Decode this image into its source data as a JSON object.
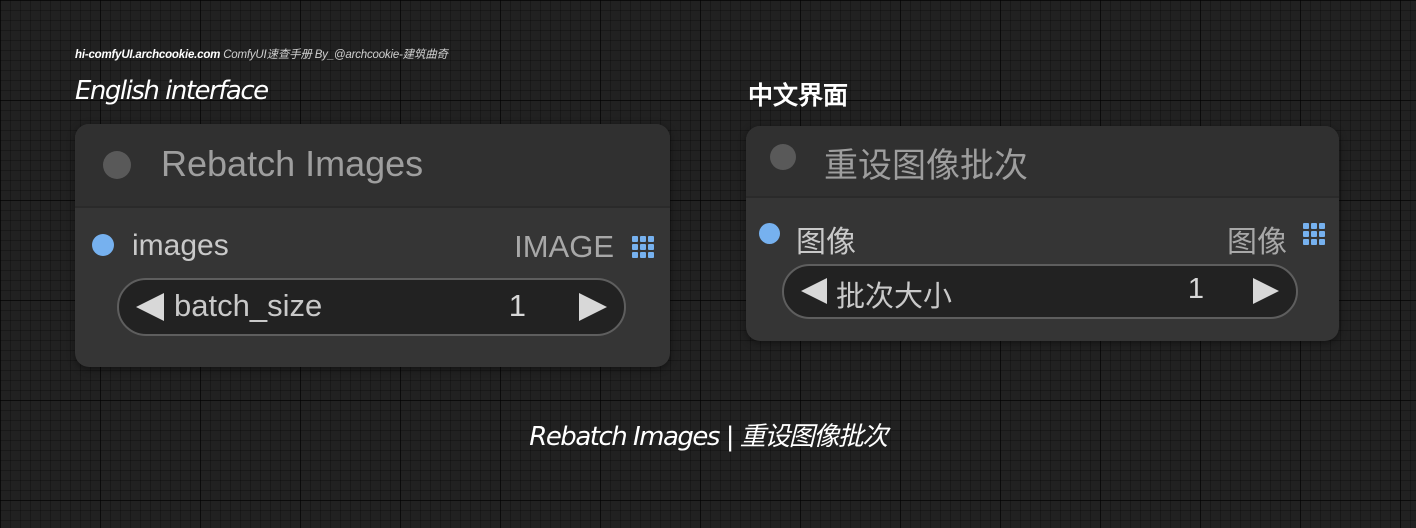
{
  "watermark": {
    "site": "hi-comfyUI.archcookie.com",
    "rest": "ComfyUI速查手册 By_@archcookie-建筑曲奇"
  },
  "labels": {
    "english": "English interface",
    "chinese": "中文界面"
  },
  "caption": "Rebatch Images | 重设图像批次",
  "nodes": {
    "english": {
      "title": "Rebatch Images",
      "input_label": "images",
      "output_type": "IMAGE",
      "widget": {
        "label": "batch_size",
        "value": "1"
      }
    },
    "chinese": {
      "title": "重设图像批次",
      "input_label": "图像",
      "output_type": "图像",
      "widget": {
        "label": "批次大小",
        "value": "1"
      }
    }
  },
  "colors": {
    "slot": "#76b1ef",
    "node_bg": "#353535",
    "canvas_bg": "#212121"
  }
}
